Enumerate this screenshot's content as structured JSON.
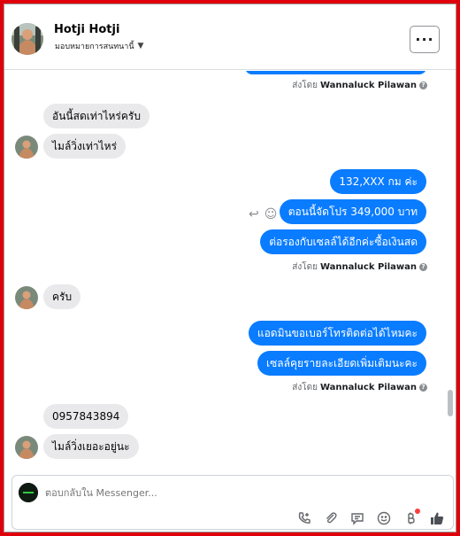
{
  "header": {
    "name": "Hotji Hotji",
    "subtitle": "มอบหมายการสนทนานี้",
    "menu_label": "···"
  },
  "messages": {
    "sent_by_label": "ส่งโดย",
    "sent_by_name": "Wannaluck Pilawan",
    "items": [
      {
        "dir": "in",
        "text": "อันนี้สดเท่าไหร่ครับ"
      },
      {
        "dir": "in",
        "text": "ไมล์วิ่งเท่าไหร่"
      },
      {
        "dir": "out",
        "text": "132,XXX  กม ค่ะ"
      },
      {
        "dir": "out",
        "text": "ตอนนี้จัดโปร 349,000 บาท"
      },
      {
        "dir": "out",
        "text": "ต่อรองกับเซลล์ได้อีกค่ะซื้อเงินสด"
      },
      {
        "dir": "in",
        "text": "ครับ"
      },
      {
        "dir": "out",
        "text": "แอดมินขอเบอร์โทรติดต่อได้ไหมคะ"
      },
      {
        "dir": "out",
        "text": "เซลล์คุยรายละเอียดเพิ่มเติมนะคะ"
      },
      {
        "dir": "in",
        "text": "0957843894"
      },
      {
        "dir": "in",
        "text": "ไมล์วิ่งเยอะอยู่นะ"
      }
    ]
  },
  "composer": {
    "placeholder": "ตอบกลับใน Messenger...",
    "tools": [
      "call-add-icon",
      "attachment-icon",
      "saved-reply-icon",
      "emoji-icon",
      "payment-icon",
      "like-icon"
    ]
  },
  "colors": {
    "accent": "#0a7cff",
    "incoming_bubble": "#e9e9eb",
    "frame": "#e0000b"
  }
}
